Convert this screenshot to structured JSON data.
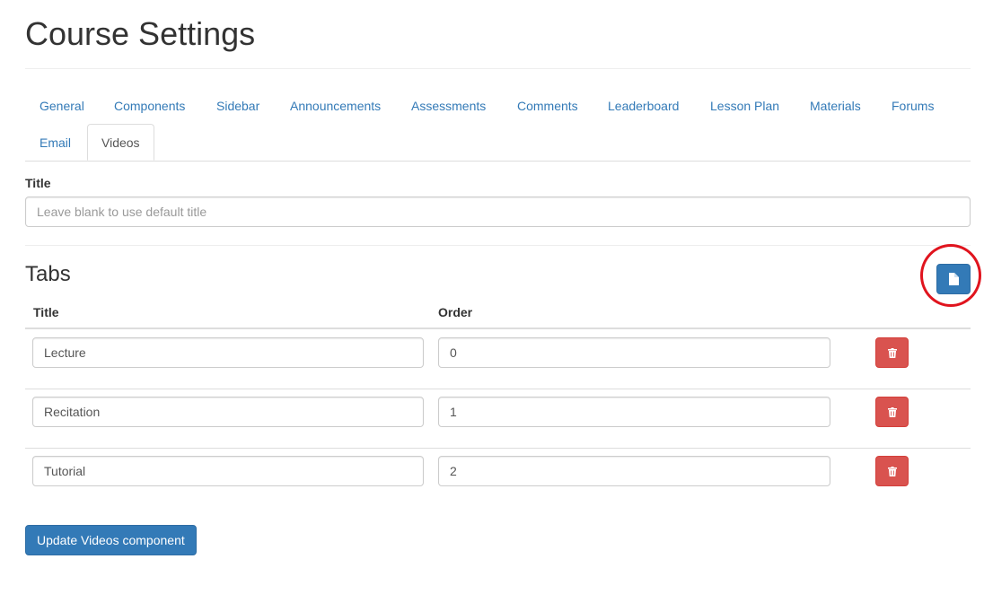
{
  "page": {
    "title": "Course Settings"
  },
  "tabs": [
    {
      "label": "General",
      "active": false
    },
    {
      "label": "Components",
      "active": false
    },
    {
      "label": "Sidebar",
      "active": false
    },
    {
      "label": "Announcements",
      "active": false
    },
    {
      "label": "Assessments",
      "active": false
    },
    {
      "label": "Comments",
      "active": false
    },
    {
      "label": "Leaderboard",
      "active": false
    },
    {
      "label": "Lesson Plan",
      "active": false
    },
    {
      "label": "Materials",
      "active": false
    },
    {
      "label": "Forums",
      "active": false
    },
    {
      "label": "Email",
      "active": false
    },
    {
      "label": "Videos",
      "active": true
    }
  ],
  "form": {
    "title_label": "Title",
    "title_value": "",
    "title_placeholder": "Leave blank to use default title"
  },
  "video_tabs": {
    "heading": "Tabs",
    "new_button_icon": "file-icon",
    "columns": {
      "title": "Title",
      "order": "Order"
    },
    "rows": [
      {
        "title": "Lecture",
        "order": "0"
      },
      {
        "title": "Recitation",
        "order": "1"
      },
      {
        "title": "Tutorial",
        "order": "2"
      }
    ],
    "delete_icon": "trash-icon"
  },
  "submit_label": "Update Videos component",
  "colors": {
    "primary": "#337ab7",
    "danger": "#d9534f",
    "link": "#337ab7",
    "highlight_circle": "#e0141e"
  }
}
